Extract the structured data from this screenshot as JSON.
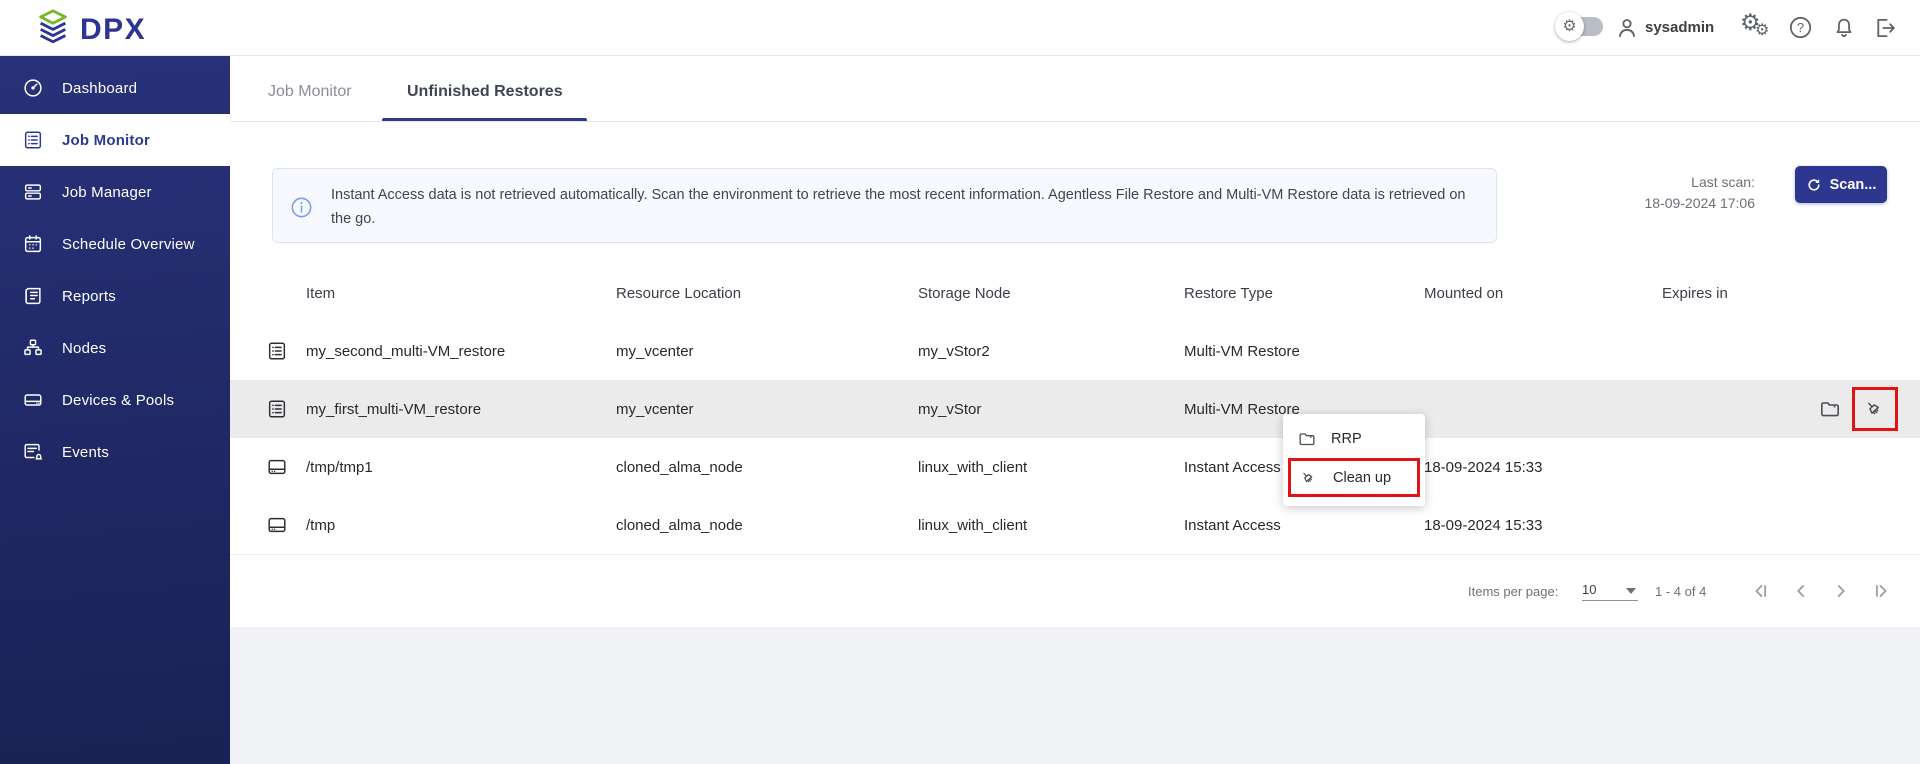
{
  "topbar": {
    "logo_text": "DPX",
    "username": "sysadmin"
  },
  "sidebar": {
    "items": [
      {
        "label": "Dashboard"
      },
      {
        "label": "Job Monitor"
      },
      {
        "label": "Job Manager"
      },
      {
        "label": "Schedule Overview"
      },
      {
        "label": "Reports"
      },
      {
        "label": "Nodes"
      },
      {
        "label": "Devices & Pools"
      },
      {
        "label": "Events"
      }
    ]
  },
  "tabs": {
    "items": [
      {
        "label": "Job Monitor"
      },
      {
        "label": "Unfinished Restores"
      }
    ]
  },
  "banner": {
    "text": "Instant Access data is not retrieved automatically. Scan the environment to retrieve the most recent information. Agentless File Restore and Multi-VM Restore data is retrieved on the go."
  },
  "scan": {
    "last_scan_label": "Last scan:",
    "last_scan_time": "18-09-2024 17:06",
    "button_label": "Scan..."
  },
  "table": {
    "columns": [
      "Item",
      "Resource Location",
      "Storage Node",
      "Restore Type",
      "Mounted on",
      "Expires in"
    ],
    "rows": [
      {
        "item": "my_second_multi-VM_restore",
        "resource_location": "my_vcenter",
        "storage_node": "my_vStor2",
        "restore_type": "Multi-VM Restore",
        "mounted_on": "",
        "expires_in": ""
      },
      {
        "item": "my_first_multi-VM_restore",
        "resource_location": "my_vcenter",
        "storage_node": "my_vStor",
        "restore_type": "Multi-VM Restore",
        "mounted_on": "",
        "expires_in": ""
      },
      {
        "item": "/tmp/tmp1",
        "resource_location": "cloned_alma_node",
        "storage_node": "linux_with_client",
        "restore_type": "Instant Access",
        "mounted_on": "18-09-2024 15:33",
        "expires_in": ""
      },
      {
        "item": "/tmp",
        "resource_location": "cloned_alma_node",
        "storage_node": "linux_with_client",
        "restore_type": "Instant Access",
        "mounted_on": "18-09-2024 15:33",
        "expires_in": ""
      }
    ]
  },
  "context_menu": {
    "items": [
      {
        "label": "RRP"
      },
      {
        "label": "Clean up"
      }
    ]
  },
  "pagination": {
    "items_per_page_label": "Items per page:",
    "items_per_page_value": "10",
    "range": "1 - 4 of 4"
  },
  "colors": {
    "accent": "#2d3790",
    "sidebar_top": "#28327a",
    "sidebar_bottom": "#1a2154",
    "highlight_red": "#e01414",
    "banner_bg": "#f7f9fe",
    "banner_border": "#dbe4f5",
    "info_icon": "#7b9ee6",
    "row_highlight": "#ebebeb",
    "logo_green": "#76b82a",
    "logo_navy": "#2d3594"
  }
}
